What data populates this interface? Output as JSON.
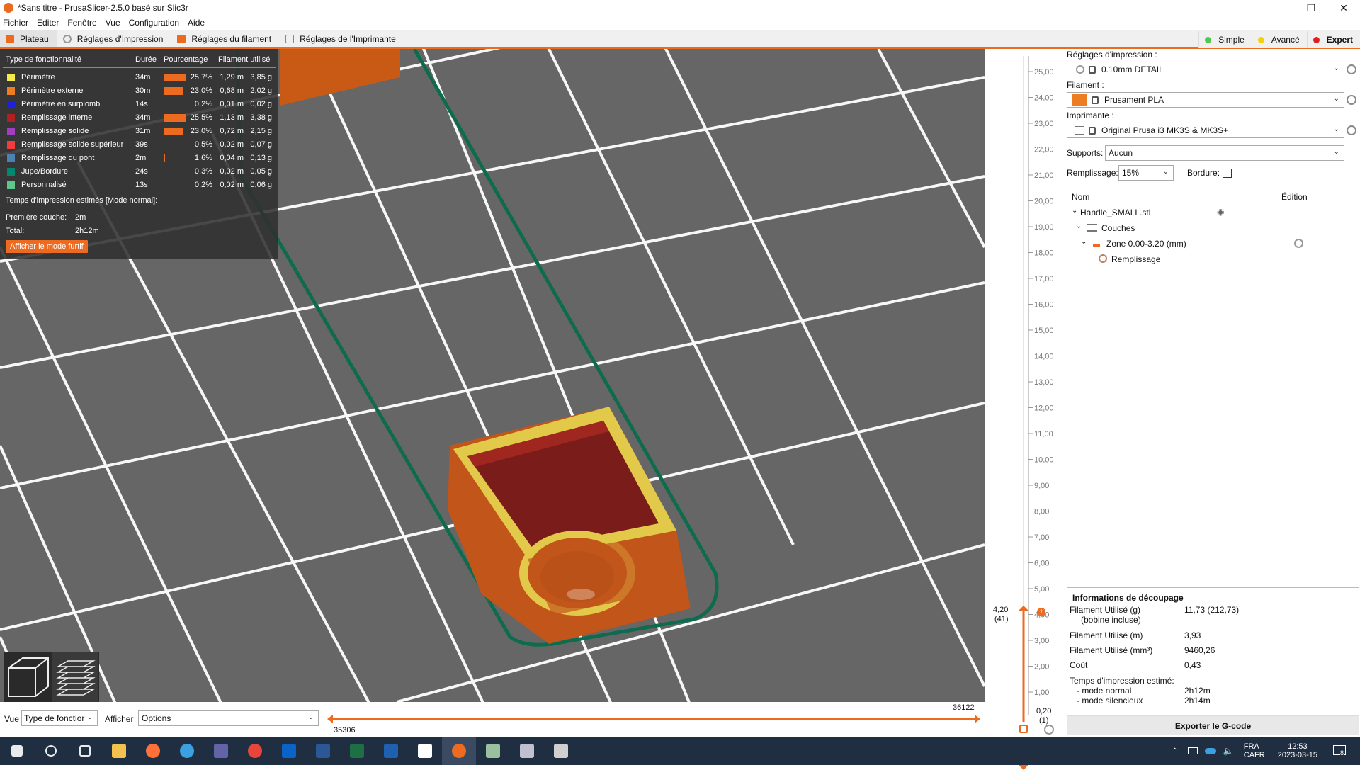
{
  "window": {
    "title": "*Sans titre - PrusaSlicer-2.5.0 basé sur Slic3r"
  },
  "menu": [
    "Fichier",
    "Editer",
    "Fenêtre",
    "Vue",
    "Configuration",
    "Aide"
  ],
  "tabs": [
    {
      "label": "Plateau",
      "color": "#ed6b21"
    },
    {
      "label": "Réglages d'Impression",
      "color": "#999999"
    },
    {
      "label": "Réglages du filament",
      "color": "#ed6b21"
    },
    {
      "label": "Réglages de l'Imprimante",
      "color": "#999999"
    }
  ],
  "modes": [
    {
      "label": "Simple",
      "color": "#4ec94e"
    },
    {
      "label": "Avancé",
      "color": "#f5d200"
    },
    {
      "label": "Expert",
      "color": "#e01e1e"
    }
  ],
  "legend": {
    "headers": [
      "Type de fonctionnalité",
      "Durée",
      "Pourcentage",
      "Filament utilisé"
    ],
    "rows": [
      {
        "name": "Périmètre",
        "color": "#f6e94a",
        "time": "34m",
        "pct": "25,7%",
        "pct_value": 25.7,
        "m": "1,29 m",
        "g": "3,85 g"
      },
      {
        "name": "Périmètre externe",
        "color": "#ed7d21",
        "time": "30m",
        "pct": "23,0%",
        "pct_value": 23.0,
        "m": "0,68 m",
        "g": "2,02 g"
      },
      {
        "name": "Périmètre en surplomb",
        "color": "#1f1fe0",
        "time": "14s",
        "pct": "0,2%",
        "pct_value": 0.2,
        "m": "0,01 m",
        "g": "0,02 g"
      },
      {
        "name": "Remplissage interne",
        "color": "#b02020",
        "time": "34m",
        "pct": "25,5%",
        "pct_value": 25.5,
        "m": "1,13 m",
        "g": "3,38 g"
      },
      {
        "name": "Remplissage solide",
        "color": "#a040c0",
        "time": "31m",
        "pct": "23,0%",
        "pct_value": 23.0,
        "m": "0,72 m",
        "g": "2,15 g"
      },
      {
        "name": "Remplissage solide supérieur",
        "color": "#f03c3c",
        "time": "39s",
        "pct": "0,5%",
        "pct_value": 0.5,
        "m": "0,02 m",
        "g": "0,07 g"
      },
      {
        "name": "Remplissage du pont",
        "color": "#4b82b4",
        "time": "2m",
        "pct": "1,6%",
        "pct_value": 1.6,
        "m": "0,04 m",
        "g": "0,13 g"
      },
      {
        "name": "Jupe/Bordure",
        "color": "#00876e",
        "time": "24s",
        "pct": "0,3%",
        "pct_value": 0.3,
        "m": "0,02 m",
        "g": "0,05 g"
      },
      {
        "name": "Personnalisé",
        "color": "#5ec68a",
        "time": "13s",
        "pct": "0,2%",
        "pct_value": 0.2,
        "m": "0,02 m",
        "g": "0,06 g"
      }
    ],
    "estimate_title": "Temps d'impression estimés [Mode normal]:",
    "first_layer_label": "Première couche:",
    "first_layer_value": "2m",
    "total_label": "Total:",
    "total_value": "2h12m",
    "stealth_button": "Afficher le mode furtif"
  },
  "vslider": {
    "ticks": [
      "25,00",
      "24,00",
      "23,00",
      "22,00",
      "21,00",
      "20,00",
      "19,00",
      "18,00",
      "17,00",
      "16,00",
      "15,00",
      "14,00",
      "13,00",
      "12,00",
      "11,00",
      "10,00",
      "9,00",
      "8,00",
      "7,00",
      "6,00",
      "5,00",
      "4,00",
      "3,00",
      "2,00",
      "1,00"
    ],
    "top_value": "4,20",
    "top_layer": "(41)",
    "bottom_value": "0,20",
    "bottom_layer": "(1)"
  },
  "sidebar": {
    "print_label": "Réglages d'impression :",
    "print_value": "0.10mm DETAIL",
    "filament_label": "Filament :",
    "filament_value": "Prusament PLA",
    "filament_color": "#ed7d21",
    "printer_label": "Imprimante :",
    "printer_value": "Original Prusa i3 MK3S & MK3S+",
    "supports_label": "Supports:",
    "supports_value": "Aucun",
    "infill_label": "Remplissage:",
    "infill_value": "15%",
    "brim_label": "Bordure:"
  },
  "tree": {
    "col_name": "Nom",
    "col_edit": "Édition",
    "object": "Handle_SMALL.stl",
    "layers": "Couches",
    "zone": "Zone 0.00-3.20 (mm)",
    "infill": "Remplissage"
  },
  "info": {
    "title": "Informations de découpage",
    "rows": [
      {
        "label": "Filament Utilisé (g)",
        "sub": "(bobine incluse)",
        "value": "11,73 (212,73)"
      },
      {
        "label": "Filament Utilisé (m)",
        "value": "3,93"
      },
      {
        "label": "Filament Utilisé (mm³)",
        "value": "9460,26"
      },
      {
        "label": "Coût",
        "value": "0,43"
      }
    ],
    "time_title": "Temps d'impression estimé:",
    "normal_label": "- mode normal",
    "normal_value": "2h12m",
    "silent_label": "- mode silencieux",
    "silent_value": "2h14m"
  },
  "export_button": "Exporter le G-code",
  "bottom": {
    "view_label": "Vue",
    "view_value": "Type de fonctior",
    "show_label": "Afficher",
    "show_value": "Options",
    "h_start": "35306",
    "h_end": "36122"
  },
  "taskbar": {
    "lang": "FRA",
    "locale": "CAFR",
    "time": "12:53",
    "date": "2023-03-15",
    "notifications": "8",
    "apps": [
      {
        "name": "windows-start-icon",
        "color": "#ffffff"
      },
      {
        "name": "search-icon",
        "color": "#ffffff"
      },
      {
        "name": "task-view-icon",
        "color": "#ffffff"
      },
      {
        "name": "file-explorer-icon",
        "color": "#f2c14e"
      },
      {
        "name": "firefox-icon",
        "color": "#ff7139"
      },
      {
        "name": "edge-icon",
        "color": "#3aa0e0"
      },
      {
        "name": "teams-icon",
        "color": "#6264a7"
      },
      {
        "name": "chrome-icon",
        "color": "#e8453c"
      },
      {
        "name": "outlook-icon",
        "color": "#0a64c8"
      },
      {
        "name": "word-icon",
        "color": "#2b5797"
      },
      {
        "name": "excel-icon",
        "color": "#1d7044"
      },
      {
        "name": "keyboard-en-icon",
        "color": "#2060b0"
      },
      {
        "name": "document-icon",
        "color": "#ffffff"
      },
      {
        "name": "prusaslicer-icon",
        "color": "#ed6b21"
      },
      {
        "name": "app-icon-a",
        "color": "#9ac0a0"
      },
      {
        "name": "app-icon-b",
        "color": "#c0c0d0"
      },
      {
        "name": "app-icon-c",
        "color": "#d0d0d0"
      }
    ]
  }
}
